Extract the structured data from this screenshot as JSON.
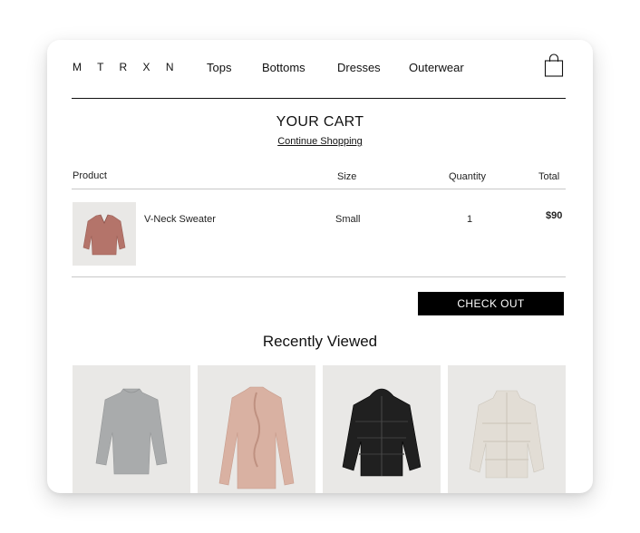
{
  "header": {
    "logo": "M T R X N",
    "nav": [
      "Tops",
      "Bottoms",
      "Dresses",
      "Outerwear"
    ],
    "cart_icon": "shopping-bag-icon"
  },
  "cart": {
    "title": "YOUR CART",
    "continue_label": "Continue Shopping",
    "columns": {
      "product": "Product",
      "size": "Size",
      "quantity": "Quantity",
      "total": "Total"
    },
    "items": [
      {
        "name": "V-Neck Sweater",
        "size": "Small",
        "quantity": "1",
        "total": "$90",
        "image": "sweater-thumbnail",
        "color": "#b4746a"
      }
    ],
    "checkout_label": "CHECK OUT"
  },
  "recently_viewed": {
    "title": "Recently Viewed",
    "items": [
      {
        "image": "grey-sweater-photo",
        "color": "#a9abac"
      },
      {
        "image": "pink-ruffle-blouse-photo",
        "color": "#d9b1a2"
      },
      {
        "image": "black-puffer-jacket-photo",
        "color": "#202020"
      },
      {
        "image": "cream-puffer-jacket-photo",
        "color": "#e2ddd5"
      }
    ]
  }
}
